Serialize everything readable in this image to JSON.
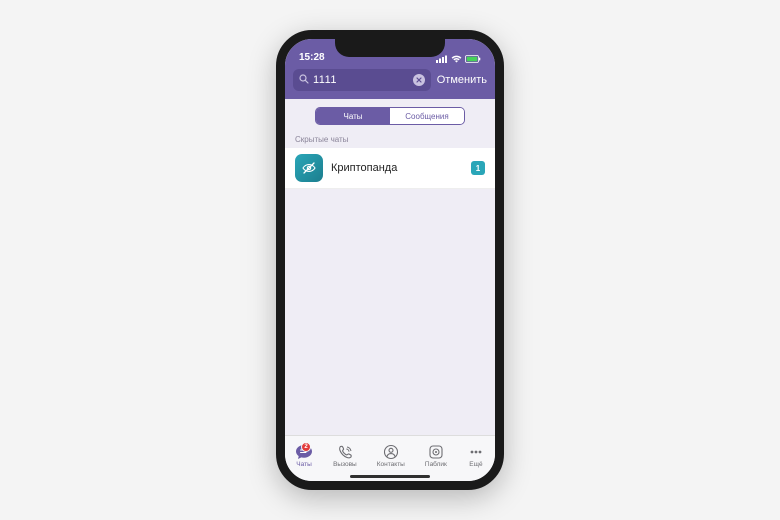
{
  "status": {
    "time": "15:28"
  },
  "search": {
    "value": "1111",
    "cancel": "Отменить"
  },
  "segments": {
    "chats": "Чаты",
    "messages": "Сообщения"
  },
  "section": {
    "hidden_chats": "Скрытые чаты"
  },
  "chats": [
    {
      "name": "Криптопанда",
      "unread": "1"
    }
  ],
  "tabs": {
    "chats": {
      "label": "Чаты",
      "badge": "2"
    },
    "calls": {
      "label": "Вызовы"
    },
    "contacts": {
      "label": "Контакты"
    },
    "public": {
      "label": "Паблик"
    },
    "more": {
      "label": "Ещё"
    }
  }
}
